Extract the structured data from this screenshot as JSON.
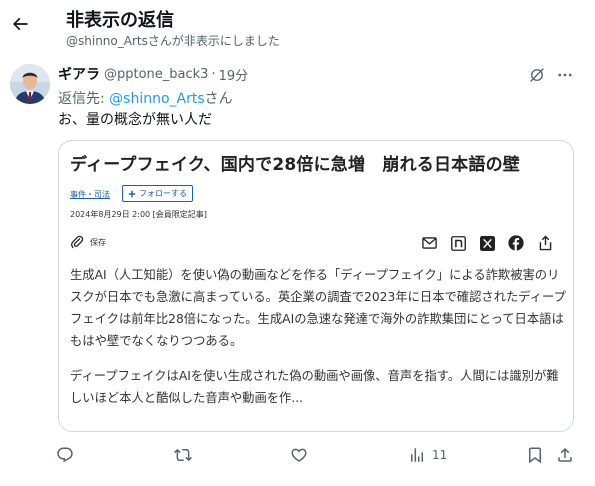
{
  "header": {
    "title": "非表示の返信",
    "subtitle": "@shinno_Artsさんが非表示にしました"
  },
  "tweet": {
    "display_name": "ギアラ",
    "handle": "@pptone_back3",
    "separator": "·",
    "time": "19分",
    "reply_prefix": "返信先: ",
    "reply_handle": "@shinno_Arts",
    "reply_suffix": "さん",
    "text": "お、量の概念が無い人だ"
  },
  "card": {
    "title": "ディープフェイク、国内で28倍に急増　崩れる日本語の壁",
    "category": "事件・司法",
    "follow_label": "フォローする",
    "date": "2024年8月29日 2:00  [会員限定記事]",
    "save_label": "保存",
    "paragraph1": "生成AI（人工知能）を使い偽の動画などを作る「ディープフェイク」による詐欺被害のリスクが日本でも急激に高まっている。英企業の調査で2023年に日本で確認されたディープフェイクは前年比28倍になった。生成AIの急速な発達で海外の詐欺集団にとって日本語はもはや壁でなくなりつつある。",
    "paragraph2": "ディープフェイクはAIを使い生成された偽の動画や画像、音声を指す。人間には識別が難しいほど本人と酷似した音声や動画を作..."
  },
  "actions": {
    "views": "11"
  },
  "icons": {
    "back": "arrow-left-icon",
    "grok": "grok-icon",
    "more": "more-icon",
    "save": "paperclip-icon",
    "mail": "mail-icon",
    "note": "note-icon",
    "x": "x-logo-icon",
    "facebook": "facebook-icon",
    "share": "share-icon",
    "reply": "reply-icon",
    "retweet": "retweet-icon",
    "like": "heart-icon",
    "views": "views-icon",
    "bookmark": "bookmark-icon"
  },
  "colors": {
    "link": "#1d9bf0",
    "secondary_text": "#536471",
    "article_blue": "#1a5fb4"
  }
}
